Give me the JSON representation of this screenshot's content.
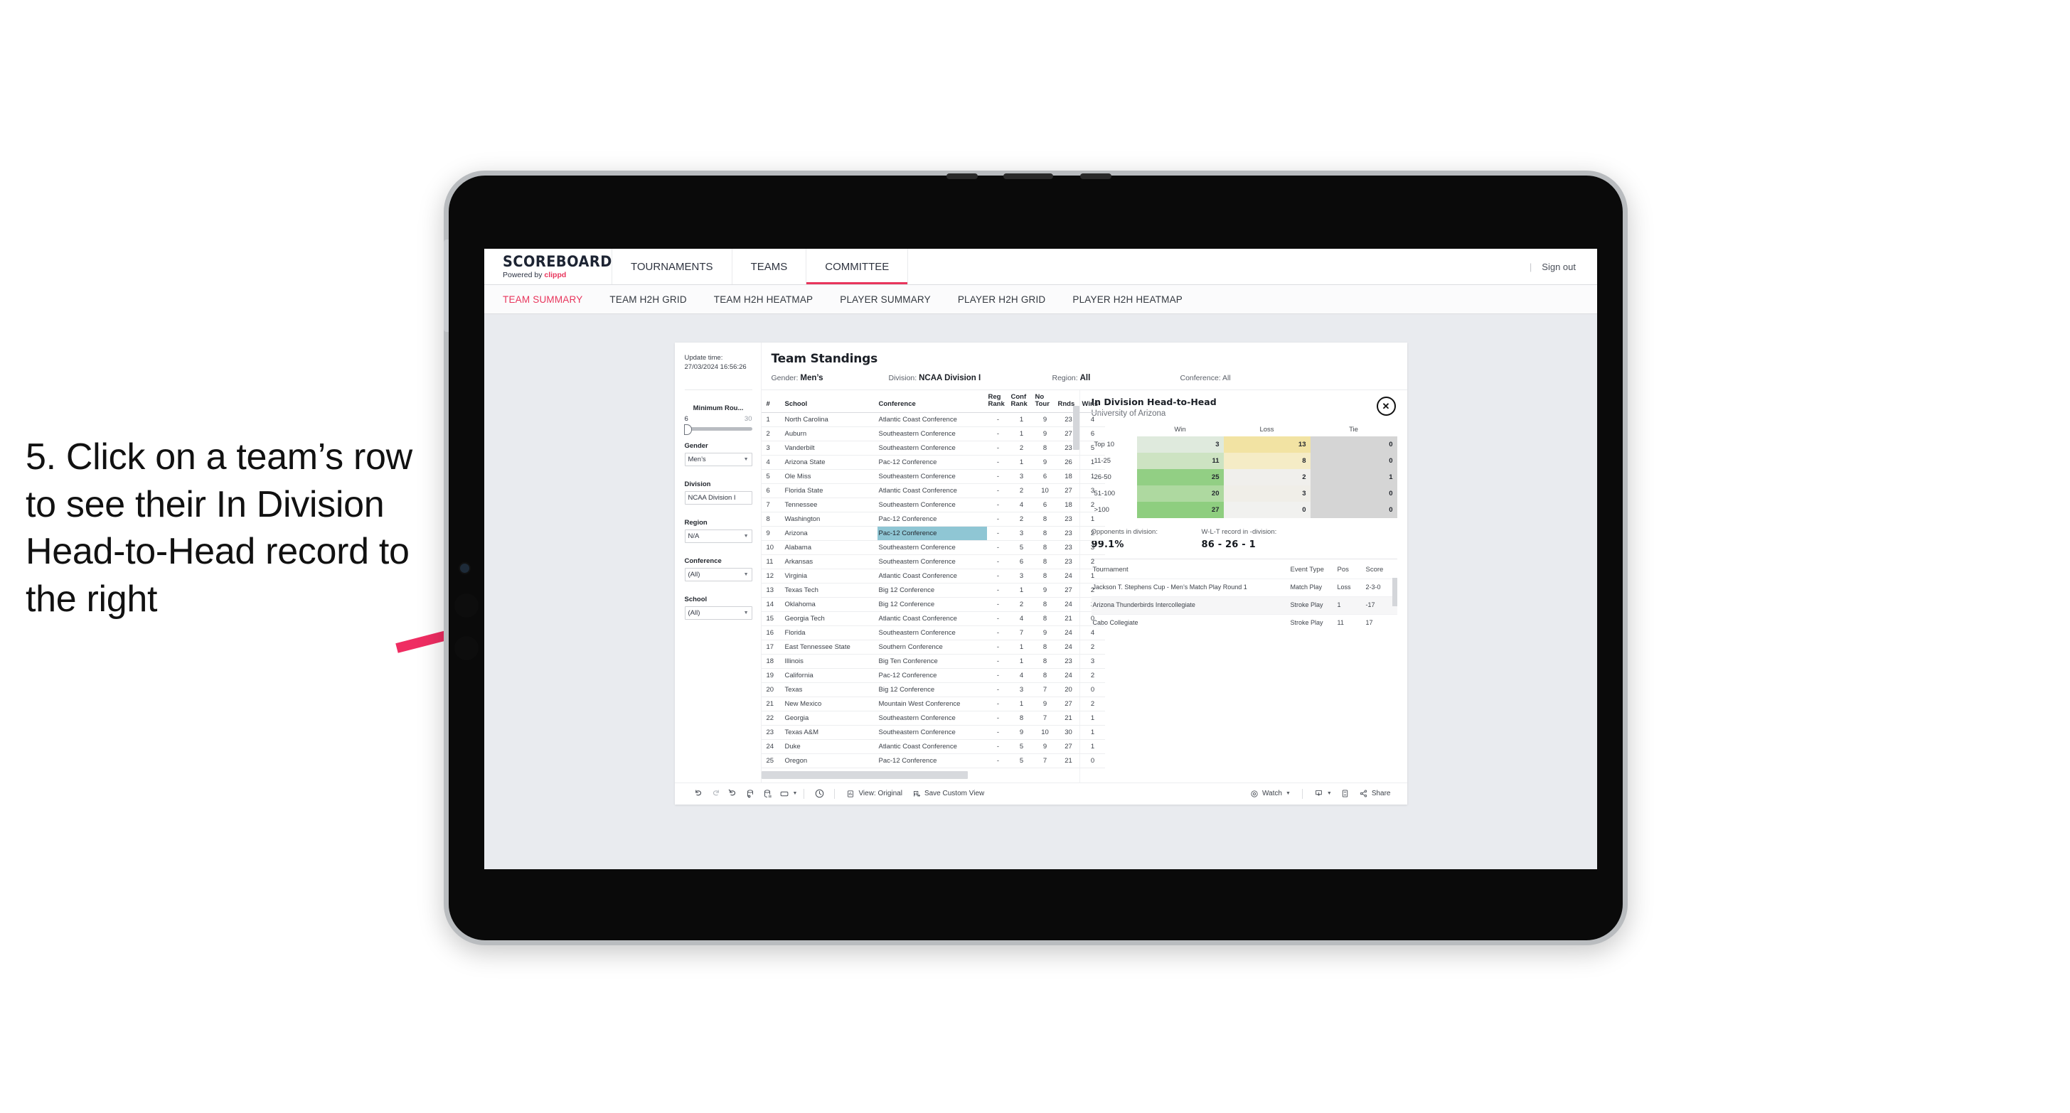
{
  "annotation": {
    "text": "5. Click on a team’s row to see their In Division Head-to-Head record to the right",
    "arrow_color": "#ef2d62"
  },
  "app": {
    "logo_word": "SCOREBOARD",
    "logo_powered_prefix": "Powered by ",
    "logo_brand": "clippd",
    "top_nav": [
      {
        "label": "TOURNAMENTS",
        "active": false
      },
      {
        "label": "TEAMS",
        "active": false
      },
      {
        "label": "COMMITTEE",
        "active": true
      }
    ],
    "sign_out": "Sign out",
    "sign_out_divider": "|",
    "sub_nav": [
      {
        "label": "TEAM SUMMARY",
        "active": true
      },
      {
        "label": "TEAM H2H GRID",
        "active": false
      },
      {
        "label": "TEAM H2H HEATMAP",
        "active": false
      },
      {
        "label": "PLAYER SUMMARY",
        "active": false
      },
      {
        "label": "PLAYER H2H GRID",
        "active": false
      },
      {
        "label": "PLAYER H2H HEATMAP",
        "active": false
      }
    ],
    "accent_color": "#e8355c"
  },
  "filters": {
    "update_time_label": "Update time:",
    "update_time_value": "27/03/2024 16:56:26",
    "slider": {
      "title": "Minimum Rou...",
      "min": "6",
      "max": "30"
    },
    "groups": [
      {
        "label": "Gender",
        "value": "Men’s",
        "has_caret": true
      },
      {
        "label": "Division",
        "value": "NCAA Division I",
        "has_caret": false
      },
      {
        "label": "Region",
        "value": "N/A",
        "has_caret": true
      },
      {
        "label": "Conference",
        "value": "(All)",
        "has_caret": true
      },
      {
        "label": "School",
        "value": "(All)",
        "has_caret": true
      }
    ]
  },
  "standings": {
    "title": "Team Standings",
    "summary": [
      {
        "label": "Gender:",
        "value": "Men’s"
      },
      {
        "label": "Division:",
        "value": "NCAA Division I"
      },
      {
        "label": "Region:",
        "value": "All"
      },
      {
        "label": "Conference:",
        "value": "All"
      }
    ],
    "columns": [
      "#",
      "School",
      "Conference",
      "Reg Rank",
      "Conf Rank",
      "No Tour",
      "Rnds",
      "Wins"
    ],
    "column_lines": [
      [
        "#",
        ""
      ],
      [
        "School",
        ""
      ],
      [
        "Conference",
        ""
      ],
      [
        "Reg",
        "Rank"
      ],
      [
        "Conf",
        "Rank"
      ],
      [
        "No",
        "Tour"
      ],
      [
        "",
        "Rnds"
      ],
      [
        "",
        "Wins"
      ]
    ],
    "highlighted_row": 9,
    "rows": [
      {
        "n": "1",
        "school": "North Carolina",
        "conf": "Atlantic Coast Conference",
        "reg": "-",
        "confr": "1",
        "notour": "9",
        "rnds": "23",
        "wins": "4"
      },
      {
        "n": "2",
        "school": "Auburn",
        "conf": "Southeastern Conference",
        "reg": "-",
        "confr": "1",
        "notour": "9",
        "rnds": "27",
        "wins": "6"
      },
      {
        "n": "3",
        "school": "Vanderbilt",
        "conf": "Southeastern Conference",
        "reg": "-",
        "confr": "2",
        "notour": "8",
        "rnds": "23",
        "wins": "5"
      },
      {
        "n": "4",
        "school": "Arizona State",
        "conf": "Pac-12 Conference",
        "reg": "-",
        "confr": "1",
        "notour": "9",
        "rnds": "26",
        "wins": "1"
      },
      {
        "n": "5",
        "school": "Ole Miss",
        "conf": "Southeastern Conference",
        "reg": "-",
        "confr": "3",
        "notour": "6",
        "rnds": "18",
        "wins": "1"
      },
      {
        "n": "6",
        "school": "Florida State",
        "conf": "Atlantic Coast Conference",
        "reg": "-",
        "confr": "2",
        "notour": "10",
        "rnds": "27",
        "wins": "3"
      },
      {
        "n": "7",
        "school": "Tennessee",
        "conf": "Southeastern Conference",
        "reg": "-",
        "confr": "4",
        "notour": "6",
        "rnds": "18",
        "wins": "2"
      },
      {
        "n": "8",
        "school": "Washington",
        "conf": "Pac-12 Conference",
        "reg": "-",
        "confr": "2",
        "notour": "8",
        "rnds": "23",
        "wins": "1"
      },
      {
        "n": "9",
        "school": "Arizona",
        "conf": "Pac-12 Conference",
        "reg": "-",
        "confr": "3",
        "notour": "8",
        "rnds": "23",
        "wins": "2"
      },
      {
        "n": "10",
        "school": "Alabama",
        "conf": "Southeastern Conference",
        "reg": "-",
        "confr": "5",
        "notour": "8",
        "rnds": "23",
        "wins": "3"
      },
      {
        "n": "11",
        "school": "Arkansas",
        "conf": "Southeastern Conference",
        "reg": "-",
        "confr": "6",
        "notour": "8",
        "rnds": "23",
        "wins": "2"
      },
      {
        "n": "12",
        "school": "Virginia",
        "conf": "Atlantic Coast Conference",
        "reg": "-",
        "confr": "3",
        "notour": "8",
        "rnds": "24",
        "wins": "1"
      },
      {
        "n": "13",
        "school": "Texas Tech",
        "conf": "Big 12 Conference",
        "reg": "-",
        "confr": "1",
        "notour": "9",
        "rnds": "27",
        "wins": "2"
      },
      {
        "n": "14",
        "school": "Oklahoma",
        "conf": "Big 12 Conference",
        "reg": "-",
        "confr": "2",
        "notour": "8",
        "rnds": "24",
        "wins": "2"
      },
      {
        "n": "15",
        "school": "Georgia Tech",
        "conf": "Atlantic Coast Conference",
        "reg": "-",
        "confr": "4",
        "notour": "8",
        "rnds": "21",
        "wins": "0"
      },
      {
        "n": "16",
        "school": "Florida",
        "conf": "Southeastern Conference",
        "reg": "-",
        "confr": "7",
        "notour": "9",
        "rnds": "24",
        "wins": "4"
      },
      {
        "n": "17",
        "school": "East Tennessee State",
        "conf": "Southern Conference",
        "reg": "-",
        "confr": "1",
        "notour": "8",
        "rnds": "24",
        "wins": "2"
      },
      {
        "n": "18",
        "school": "Illinois",
        "conf": "Big Ten Conference",
        "reg": "-",
        "confr": "1",
        "notour": "8",
        "rnds": "23",
        "wins": "3"
      },
      {
        "n": "19",
        "school": "California",
        "conf": "Pac-12 Conference",
        "reg": "-",
        "confr": "4",
        "notour": "8",
        "rnds": "24",
        "wins": "2"
      },
      {
        "n": "20",
        "school": "Texas",
        "conf": "Big 12 Conference",
        "reg": "-",
        "confr": "3",
        "notour": "7",
        "rnds": "20",
        "wins": "0"
      },
      {
        "n": "21",
        "school": "New Mexico",
        "conf": "Mountain West Conference",
        "reg": "-",
        "confr": "1",
        "notour": "9",
        "rnds": "27",
        "wins": "2"
      },
      {
        "n": "22",
        "school": "Georgia",
        "conf": "Southeastern Conference",
        "reg": "-",
        "confr": "8",
        "notour": "7",
        "rnds": "21",
        "wins": "1"
      },
      {
        "n": "23",
        "school": "Texas A&M",
        "conf": "Southeastern Conference",
        "reg": "-",
        "confr": "9",
        "notour": "10",
        "rnds": "30",
        "wins": "1"
      },
      {
        "n": "24",
        "school": "Duke",
        "conf": "Atlantic Coast Conference",
        "reg": "-",
        "confr": "5",
        "notour": "9",
        "rnds": "27",
        "wins": "1"
      },
      {
        "n": "25",
        "school": "Oregon",
        "conf": "Pac-12 Conference",
        "reg": "-",
        "confr": "5",
        "notour": "7",
        "rnds": "21",
        "wins": "0"
      }
    ]
  },
  "h2h": {
    "title": "In Division Head-to-Head",
    "subtitle": "University of Arizona",
    "close_glyph": "✕",
    "columns": [
      "",
      "Win",
      "Loss",
      "Tie"
    ],
    "rows": [
      {
        "bucket": "Top 10",
        "win": "3",
        "loss": "13",
        "tie": "0",
        "win_bg": "#dfeadd",
        "loss_bg": "#f2e3a3",
        "tie_bg": "#d5d5d5"
      },
      {
        "bucket": "11-25",
        "win": "11",
        "loss": "8",
        "tie": "0",
        "win_bg": "#cde3c2",
        "loss_bg": "#f5ecc6",
        "tie_bg": "#d5d5d5"
      },
      {
        "bucket": "26-50",
        "win": "25",
        "loss": "2",
        "tie": "1",
        "win_bg": "#92cf84",
        "loss_bg": "#f0efec",
        "tie_bg": "#d5d5d5"
      },
      {
        "bucket": "51-100",
        "win": "20",
        "loss": "3",
        "tie": "0",
        "win_bg": "#aed9a0",
        "loss_bg": "#f0eee8",
        "tie_bg": "#d5d5d5"
      },
      {
        "bucket": ">100",
        "win": "27",
        "loss": "0",
        "tie": "0",
        "win_bg": "#8ece7f",
        "loss_bg": "#f1f1ef",
        "tie_bg": "#d5d5d5"
      }
    ],
    "stats": [
      {
        "label": "Opponents in division:",
        "value": "99.1%"
      },
      {
        "label": "W-L-T record in -division:",
        "value": "86 - 26 - 1"
      }
    ],
    "tournaments": {
      "columns": [
        "Tournament",
        "Event Type",
        "Pos",
        "Score"
      ],
      "rows": [
        {
          "tournament": "Jackson T. Stephens Cup - Men’s Match Play Round 1",
          "event_type": "Match Play",
          "pos": "Loss",
          "score": "2-3-0"
        },
        {
          "tournament": "Arizona Thunderbirds Intercollegiate",
          "event_type": "Stroke Play",
          "pos": "1",
          "score": "-17"
        },
        {
          "tournament": "Cabo Collegiate",
          "event_type": "Stroke Play",
          "pos": "11",
          "score": "17"
        }
      ]
    }
  },
  "toolbar": {
    "icons": [
      "undo-icon",
      "redo-icon",
      "revert-icon",
      "refresh-data-icon",
      "pause-refresh-icon",
      "device-layout-icon"
    ],
    "alerts_label": "",
    "view_original_label": "View: Original",
    "save_custom_view_label": "Save Custom View",
    "watch_label": "Watch",
    "share_label": "Share"
  }
}
